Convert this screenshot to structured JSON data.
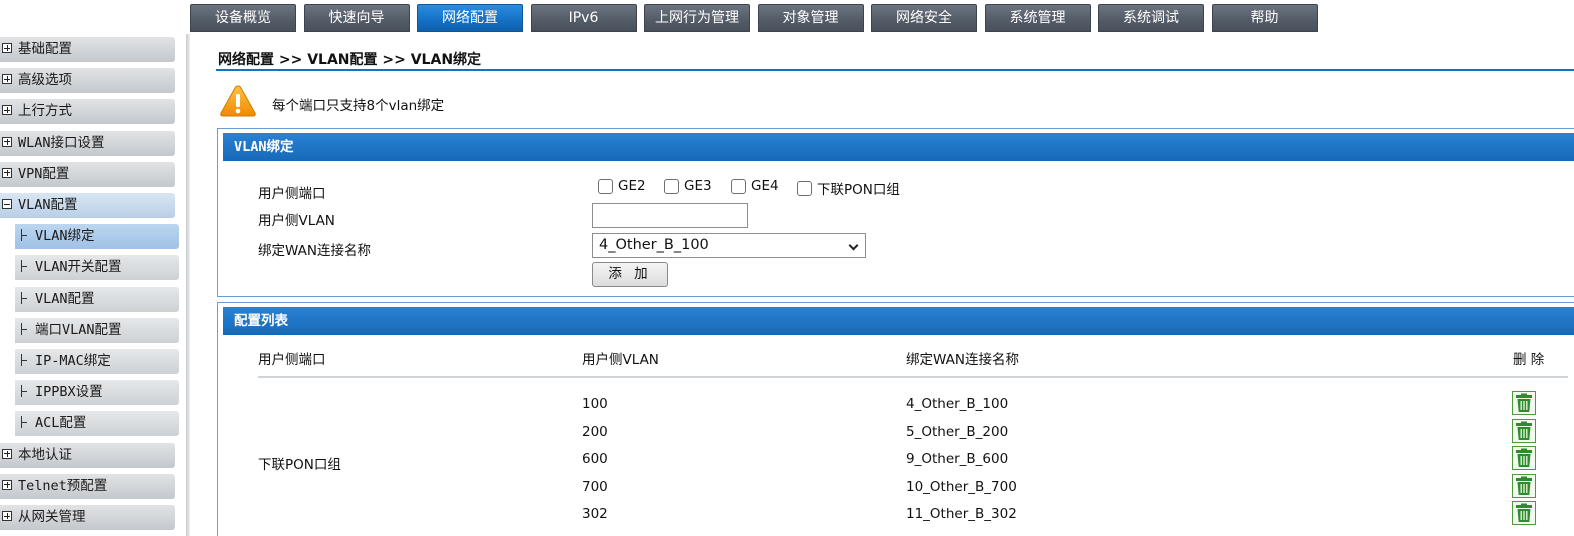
{
  "nav": {
    "tabs": [
      "设备概览",
      "快速向导",
      "网络配置",
      "IPv6",
      "上网行为管理",
      "对象管理",
      "网络安全",
      "系统管理",
      "系统调试",
      "帮助"
    ],
    "active": "网络配置"
  },
  "sidebar": {
    "items_top": [
      "基础配置",
      "高级选项",
      "上行方式",
      "WLAN接口设置",
      "VPN配置"
    ],
    "open_item": "VLAN配置",
    "sub_items": [
      "VLAN绑定",
      "VLAN开关配置",
      "VLAN配置",
      "端口VLAN配置",
      "IP-MAC绑定",
      "IPPBX设置",
      "ACL配置"
    ],
    "active_sub": "VLAN绑定",
    "items_bottom": [
      "本地认证",
      "Telnet预配置",
      "从网关管理"
    ]
  },
  "breadcrumb": "网络配置 >> VLAN配置 >> VLAN绑定",
  "notice": "每个端口只支持8个vlan绑定",
  "form": {
    "title": "VLAN绑定",
    "port_label": "用户侧端口",
    "ports": [
      "GE2",
      "GE3",
      "GE4",
      "下联PON口组"
    ],
    "vlan_label": "用户侧VLAN",
    "vlan_value": "",
    "wan_label": "绑定WAN连接名称",
    "wan_selected": "4_Other_B_100",
    "add_label": "添 加"
  },
  "list": {
    "title": "配置列表",
    "headers": [
      "用户侧端口",
      "用户侧VLAN",
      "绑定WAN连接名称",
      "删 除"
    ],
    "group_port": "下联PON口组",
    "rows": [
      {
        "vlan": "100",
        "wan": "4_Other_B_100"
      },
      {
        "vlan": "200",
        "wan": "5_Other_B_200"
      },
      {
        "vlan": "600",
        "wan": "9_Other_B_600"
      },
      {
        "vlan": "700",
        "wan": "10_Other_B_700"
      },
      {
        "vlan": "302",
        "wan": "11_Other_B_302"
      }
    ]
  },
  "colors": {
    "accent_blue": "#1670c6",
    "nav_gray": "#545d68",
    "delete_green": "#2e8b2e"
  },
  "icons": {
    "notice": "warning-icon",
    "delete": "trash-icon"
  }
}
